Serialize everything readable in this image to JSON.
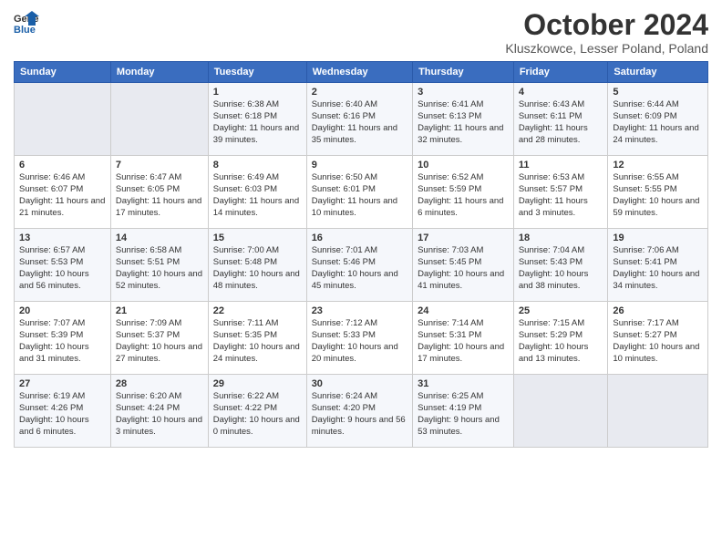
{
  "header": {
    "logo_general": "General",
    "logo_blue": "Blue",
    "title": "October 2024",
    "subtitle": "Kluszkowce, Lesser Poland, Poland"
  },
  "weekdays": [
    "Sunday",
    "Monday",
    "Tuesday",
    "Wednesday",
    "Thursday",
    "Friday",
    "Saturday"
  ],
  "weeks": [
    [
      {
        "day": "",
        "info": ""
      },
      {
        "day": "",
        "info": ""
      },
      {
        "day": "1",
        "info": "Sunrise: 6:38 AM\nSunset: 6:18 PM\nDaylight: 11 hours and 39 minutes."
      },
      {
        "day": "2",
        "info": "Sunrise: 6:40 AM\nSunset: 6:16 PM\nDaylight: 11 hours and 35 minutes."
      },
      {
        "day": "3",
        "info": "Sunrise: 6:41 AM\nSunset: 6:13 PM\nDaylight: 11 hours and 32 minutes."
      },
      {
        "day": "4",
        "info": "Sunrise: 6:43 AM\nSunset: 6:11 PM\nDaylight: 11 hours and 28 minutes."
      },
      {
        "day": "5",
        "info": "Sunrise: 6:44 AM\nSunset: 6:09 PM\nDaylight: 11 hours and 24 minutes."
      }
    ],
    [
      {
        "day": "6",
        "info": "Sunrise: 6:46 AM\nSunset: 6:07 PM\nDaylight: 11 hours and 21 minutes."
      },
      {
        "day": "7",
        "info": "Sunrise: 6:47 AM\nSunset: 6:05 PM\nDaylight: 11 hours and 17 minutes."
      },
      {
        "day": "8",
        "info": "Sunrise: 6:49 AM\nSunset: 6:03 PM\nDaylight: 11 hours and 14 minutes."
      },
      {
        "day": "9",
        "info": "Sunrise: 6:50 AM\nSunset: 6:01 PM\nDaylight: 11 hours and 10 minutes."
      },
      {
        "day": "10",
        "info": "Sunrise: 6:52 AM\nSunset: 5:59 PM\nDaylight: 11 hours and 6 minutes."
      },
      {
        "day": "11",
        "info": "Sunrise: 6:53 AM\nSunset: 5:57 PM\nDaylight: 11 hours and 3 minutes."
      },
      {
        "day": "12",
        "info": "Sunrise: 6:55 AM\nSunset: 5:55 PM\nDaylight: 10 hours and 59 minutes."
      }
    ],
    [
      {
        "day": "13",
        "info": "Sunrise: 6:57 AM\nSunset: 5:53 PM\nDaylight: 10 hours and 56 minutes."
      },
      {
        "day": "14",
        "info": "Sunrise: 6:58 AM\nSunset: 5:51 PM\nDaylight: 10 hours and 52 minutes."
      },
      {
        "day": "15",
        "info": "Sunrise: 7:00 AM\nSunset: 5:48 PM\nDaylight: 10 hours and 48 minutes."
      },
      {
        "day": "16",
        "info": "Sunrise: 7:01 AM\nSunset: 5:46 PM\nDaylight: 10 hours and 45 minutes."
      },
      {
        "day": "17",
        "info": "Sunrise: 7:03 AM\nSunset: 5:45 PM\nDaylight: 10 hours and 41 minutes."
      },
      {
        "day": "18",
        "info": "Sunrise: 7:04 AM\nSunset: 5:43 PM\nDaylight: 10 hours and 38 minutes."
      },
      {
        "day": "19",
        "info": "Sunrise: 7:06 AM\nSunset: 5:41 PM\nDaylight: 10 hours and 34 minutes."
      }
    ],
    [
      {
        "day": "20",
        "info": "Sunrise: 7:07 AM\nSunset: 5:39 PM\nDaylight: 10 hours and 31 minutes."
      },
      {
        "day": "21",
        "info": "Sunrise: 7:09 AM\nSunset: 5:37 PM\nDaylight: 10 hours and 27 minutes."
      },
      {
        "day": "22",
        "info": "Sunrise: 7:11 AM\nSunset: 5:35 PM\nDaylight: 10 hours and 24 minutes."
      },
      {
        "day": "23",
        "info": "Sunrise: 7:12 AM\nSunset: 5:33 PM\nDaylight: 10 hours and 20 minutes."
      },
      {
        "day": "24",
        "info": "Sunrise: 7:14 AM\nSunset: 5:31 PM\nDaylight: 10 hours and 17 minutes."
      },
      {
        "day": "25",
        "info": "Sunrise: 7:15 AM\nSunset: 5:29 PM\nDaylight: 10 hours and 13 minutes."
      },
      {
        "day": "26",
        "info": "Sunrise: 7:17 AM\nSunset: 5:27 PM\nDaylight: 10 hours and 10 minutes."
      }
    ],
    [
      {
        "day": "27",
        "info": "Sunrise: 6:19 AM\nSunset: 4:26 PM\nDaylight: 10 hours and 6 minutes."
      },
      {
        "day": "28",
        "info": "Sunrise: 6:20 AM\nSunset: 4:24 PM\nDaylight: 10 hours and 3 minutes."
      },
      {
        "day": "29",
        "info": "Sunrise: 6:22 AM\nSunset: 4:22 PM\nDaylight: 10 hours and 0 minutes."
      },
      {
        "day": "30",
        "info": "Sunrise: 6:24 AM\nSunset: 4:20 PM\nDaylight: 9 hours and 56 minutes."
      },
      {
        "day": "31",
        "info": "Sunrise: 6:25 AM\nSunset: 4:19 PM\nDaylight: 9 hours and 53 minutes."
      },
      {
        "day": "",
        "info": ""
      },
      {
        "day": "",
        "info": ""
      }
    ]
  ]
}
